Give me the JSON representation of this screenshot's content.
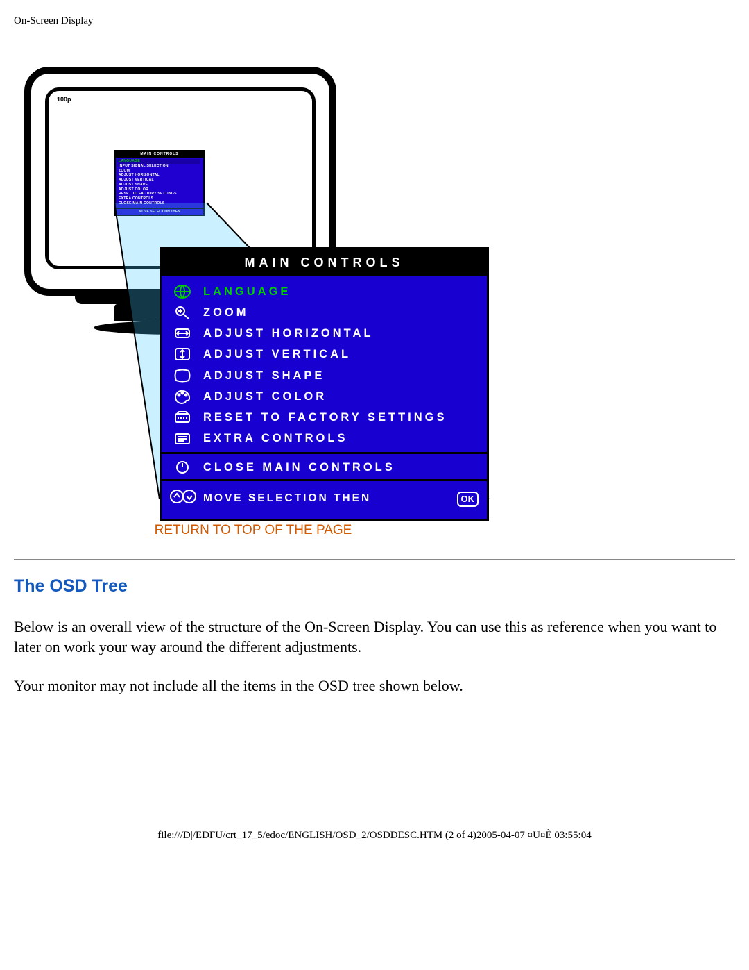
{
  "page_title": "On-Screen Display",
  "monitor": {
    "brand_text": "100p"
  },
  "mini_osd": {
    "header": "MAIN CONTROLS",
    "items": [
      "LANGUAGE",
      "INPUT SIGNAL SELECTION",
      "ZOOM",
      "ADJUST HORIZONTAL",
      "ADJUST VERTICAL",
      "ADJUST SHAPE",
      "ADJUST COLOR",
      "RESET TO FACTORY SETTINGS",
      "EXTRA CONTROLS",
      "CLOSE MAIN CONTROLS"
    ],
    "footer": "MOVE SELECTION THEN"
  },
  "osd": {
    "header": "MAIN CONTROLS",
    "items": [
      {
        "icon": "language-icon",
        "label": "LANGUAGE",
        "selected": true
      },
      {
        "icon": "zoom-icon",
        "label": "ZOOM",
        "selected": false
      },
      {
        "icon": "horiz-icon",
        "label": "ADJUST HORIZONTAL",
        "selected": false
      },
      {
        "icon": "vert-icon",
        "label": "ADJUST VERTICAL",
        "selected": false
      },
      {
        "icon": "shape-icon",
        "label": "ADJUST SHAPE",
        "selected": false
      },
      {
        "icon": "color-icon",
        "label": "ADJUST COLOR",
        "selected": false
      },
      {
        "icon": "reset-icon",
        "label": "RESET TO FACTORY SETTINGS",
        "selected": false
      },
      {
        "icon": "extra-icon",
        "label": "EXTRA CONTROLS",
        "selected": false
      }
    ],
    "close": {
      "icon": "close-icon",
      "label": "CLOSE MAIN CONTROLS"
    },
    "footer_label": "MOVE SELECTION THEN",
    "footer_ok": "OK"
  },
  "return_link": "RETURN TO TOP OF THE PAGE",
  "section_heading": "The OSD Tree",
  "para1": "Below is an overall view of the structure of the On-Screen Display. You can use this as reference when you want to later on work your way around the different adjustments.",
  "para2": "Your monitor may not include all the items in the OSD tree shown below.",
  "footer_path": "file:///D|/EDFU/crt_17_5/edoc/ENGLISH/OSD_2/OSDDESC.HTM (2 of 4)2005-04-07 ¤U¤È 03:55:04"
}
